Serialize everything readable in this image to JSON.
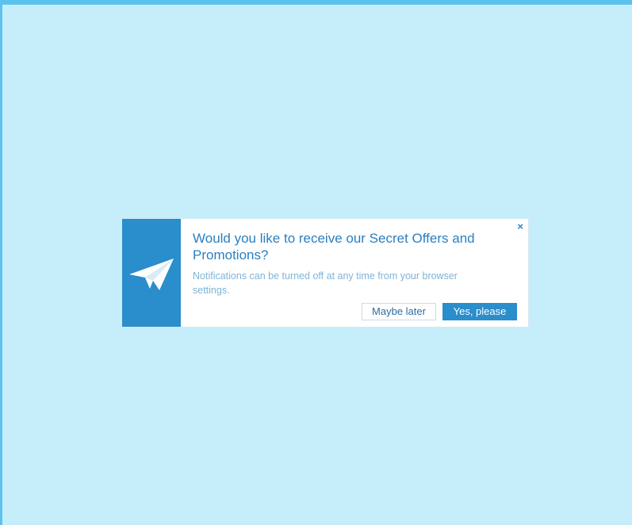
{
  "popup": {
    "title": "Would you like to receive our Secret Offers and Promotions?",
    "description": "Notifications can be turned off at any time from your browser settings.",
    "close_label": "×",
    "icon": "paper-plane-icon",
    "buttons": {
      "later_label": "Maybe later",
      "yes_label": "Yes, please"
    }
  },
  "colors": {
    "background": "#c5eefa",
    "frame_border": "#5cc2ec",
    "accent": "#2a8dcc",
    "title": "#2a7fc0",
    "description": "#7fb4d8"
  }
}
